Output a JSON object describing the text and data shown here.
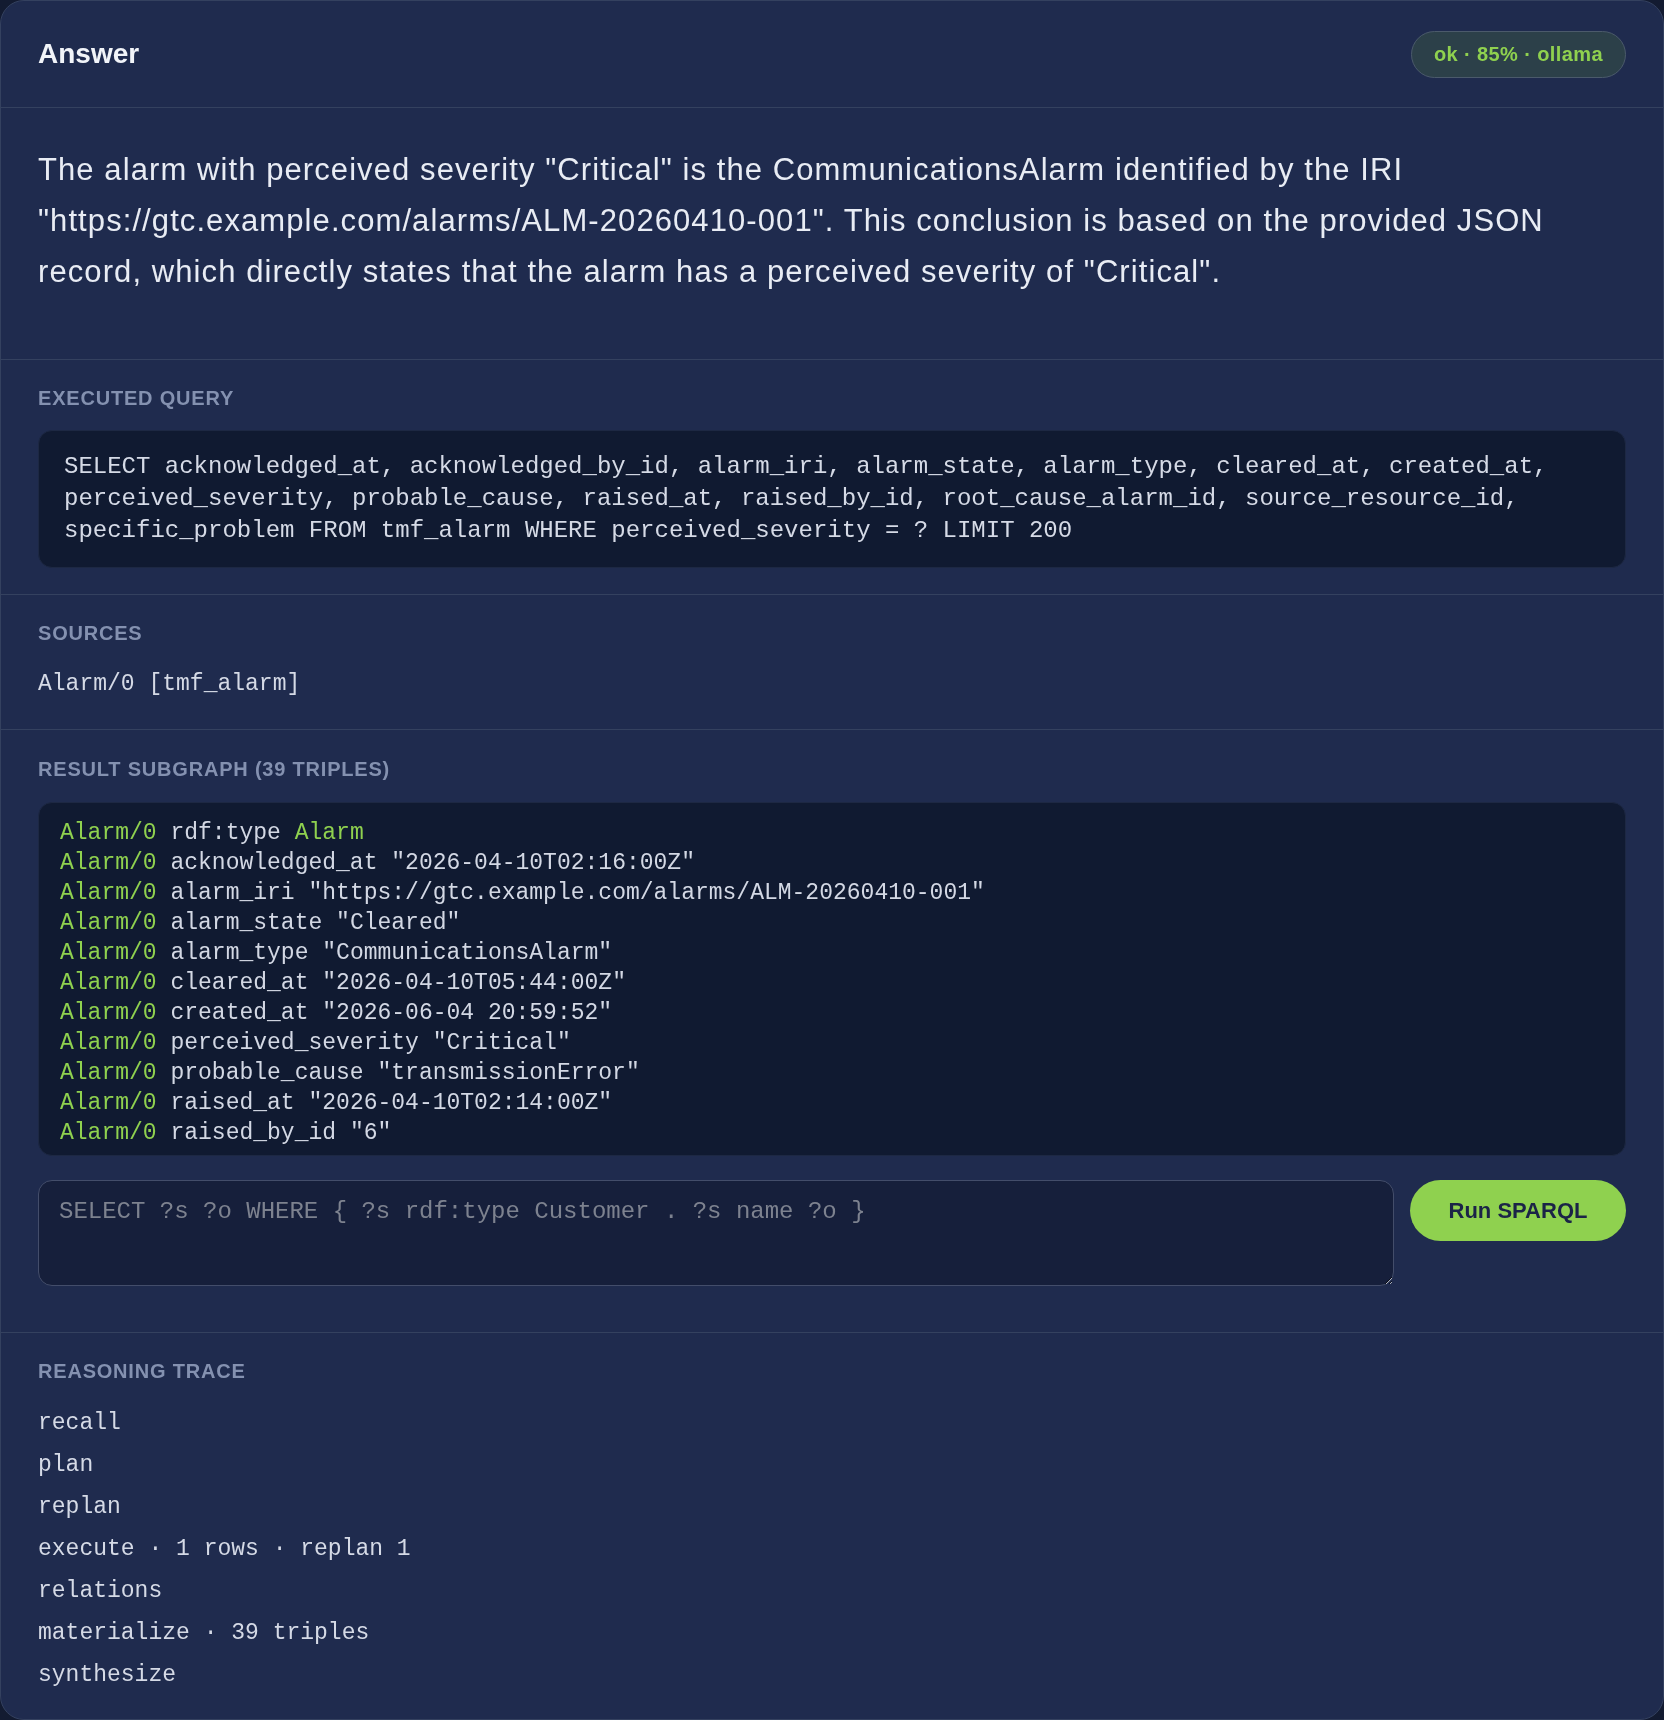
{
  "header": {
    "title": "Answer",
    "badge": "ok · 85% · ollama"
  },
  "answer": {
    "text": "The alarm with perceived severity \"Critical\" is the CommunicationsAlarm identified by the IRI \"https://gtc.example.com/alarms/ALM-20260410-001\". This conclusion is based on the provided JSON record, which directly states that the alarm has a perceived severity of \"Critical\"."
  },
  "executed_query": {
    "label": "EXECUTED QUERY",
    "query": "SELECT acknowledged_at, acknowledged_by_id, alarm_iri, alarm_state, alarm_type, cleared_at, created_at, perceived_severity, probable_cause, raised_at, raised_by_id, root_cause_alarm_id, source_resource_id, specific_problem FROM tmf_alarm WHERE perceived_severity = ? LIMIT 200"
  },
  "sources": {
    "label": "SOURCES",
    "items": [
      "Alarm/0 [tmf_alarm]"
    ]
  },
  "result_subgraph": {
    "label": "RESULT SUBGRAPH (39 TRIPLES)",
    "triples": [
      {
        "kind": "type",
        "subject": "Alarm/0",
        "predicate": "rdf:type",
        "object": "Alarm"
      },
      {
        "kind": "literal",
        "subject": "Alarm/0",
        "predicate": "acknowledged_at",
        "object": "\"2026-04-10T02:16:00Z\""
      },
      {
        "kind": "literal",
        "subject": "Alarm/0",
        "predicate": "alarm_iri",
        "object": "\"https://gtc.example.com/alarms/ALM-20260410-001\""
      },
      {
        "kind": "literal",
        "subject": "Alarm/0",
        "predicate": "alarm_state",
        "object": "\"Cleared\""
      },
      {
        "kind": "literal",
        "subject": "Alarm/0",
        "predicate": "alarm_type",
        "object": "\"CommunicationsAlarm\""
      },
      {
        "kind": "literal",
        "subject": "Alarm/0",
        "predicate": "cleared_at",
        "object": "\"2026-04-10T05:44:00Z\""
      },
      {
        "kind": "literal",
        "subject": "Alarm/0",
        "predicate": "created_at",
        "object": "\"2026-06-04 20:59:52\""
      },
      {
        "kind": "literal",
        "subject": "Alarm/0",
        "predicate": "perceived_severity",
        "object": "\"Critical\""
      },
      {
        "kind": "literal",
        "subject": "Alarm/0",
        "predicate": "probable_cause",
        "object": "\"transmissionError\""
      },
      {
        "kind": "literal",
        "subject": "Alarm/0",
        "predicate": "raised_at",
        "object": "\"2026-04-10T02:14:00Z\""
      },
      {
        "kind": "literal",
        "subject": "Alarm/0",
        "predicate": "raised_by_id",
        "object": "\"6\""
      }
    ]
  },
  "sparql_editor": {
    "placeholder": "SELECT ?s ?o WHERE { ?s rdf:type Customer . ?s name ?o }",
    "button": "Run SPARQL"
  },
  "reasoning_trace": {
    "label": "REASONING TRACE",
    "steps": [
      "recall",
      "plan",
      "replan",
      "execute · 1 rows · replan 1",
      "relations",
      "materialize · 39 triples",
      "synthesize"
    ]
  }
}
